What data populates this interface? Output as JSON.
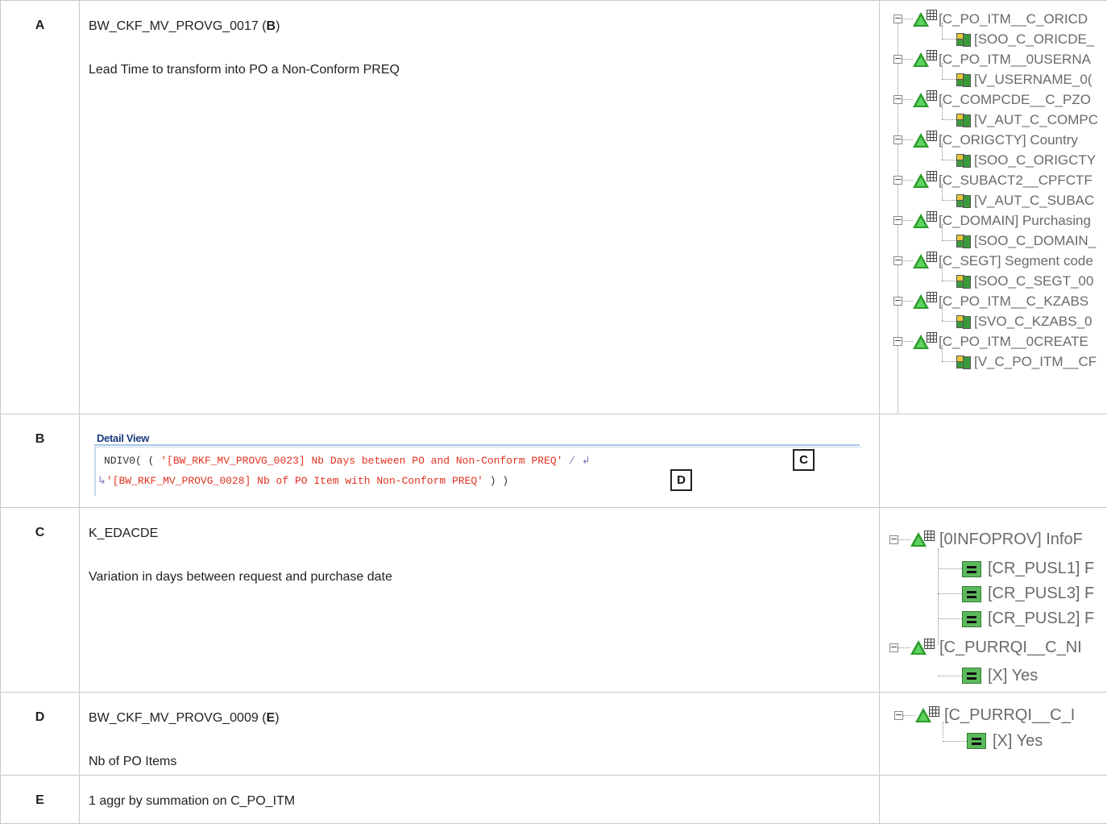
{
  "rows": [
    {
      "key": "A",
      "name": "BW_CKF_MV_PROVG_0017",
      "ref": "B",
      "desc": "Lead Time to transform into PO a Non-Conform PREQ"
    },
    {
      "key": "B"
    },
    {
      "key": "C",
      "name": "K_EDACDE",
      "desc": "Variation in days between request and purchase date"
    },
    {
      "key": "D",
      "name": "BW_CKF_MV_PROVG_0009",
      "ref": "E",
      "desc": "Nb of PO Items"
    },
    {
      "key": "E",
      "name": "1 aggr by summation on C_PO_ITM"
    }
  ],
  "treeA": [
    {
      "char": "[C_PO_ITM__C_ORICD",
      "filter": "[SOO_C_ORICDE_"
    },
    {
      "char": "[C_PO_ITM__0USERNA",
      "filter": "[V_USERNAME_0("
    },
    {
      "char": "[C_COMPCDE__C_PZO",
      "filter": "[V_AUT_C_COMPC"
    },
    {
      "char": "[C_ORIGCTY] Country",
      "filter": "[SOO_C_ORIGCTY"
    },
    {
      "char": "[C_SUBACT2__CPFCTF",
      "filter": "[V_AUT_C_SUBAC"
    },
    {
      "char": "[C_DOMAIN] Purchasing",
      "filter": "[SOO_C_DOMAIN_"
    },
    {
      "char": "[C_SEGT] Segment code",
      "filter": "[SOO_C_SEGT_00"
    },
    {
      "char": "[C_PO_ITM__C_KZABS",
      "filter": "[SVO_C_KZABS_0"
    },
    {
      "char": "[C_PO_ITM__0CREATE",
      "filter": "[V_C_PO_ITM__CF"
    }
  ],
  "detailView": {
    "title": "Detail View",
    "line1_fn": "NDIV0( ( ",
    "line1_str": "'[BW_RKF_MV_PROVG_0023] Nb Days between PO and Non-Conform PREQ'",
    "line1_op": " / ",
    "line2_str": "'[BW_RKF_MV_PROVG_0028] Nb of PO Item with Non-Conform PREQ'",
    "line2_end": " ) )",
    "callout_c": "C",
    "callout_d": "D"
  },
  "treeC": {
    "root": "[0INFOPROV] InfoF",
    "children": [
      "[CR_PUSL1] F",
      "[CR_PUSL3] F",
      "[CR_PUSL2] F"
    ],
    "second": "[C_PURRQI__C_NI",
    "second_child": "[X] Yes"
  },
  "treeD": {
    "root": "[C_PURRQI__C_I",
    "child": "[X] Yes"
  }
}
